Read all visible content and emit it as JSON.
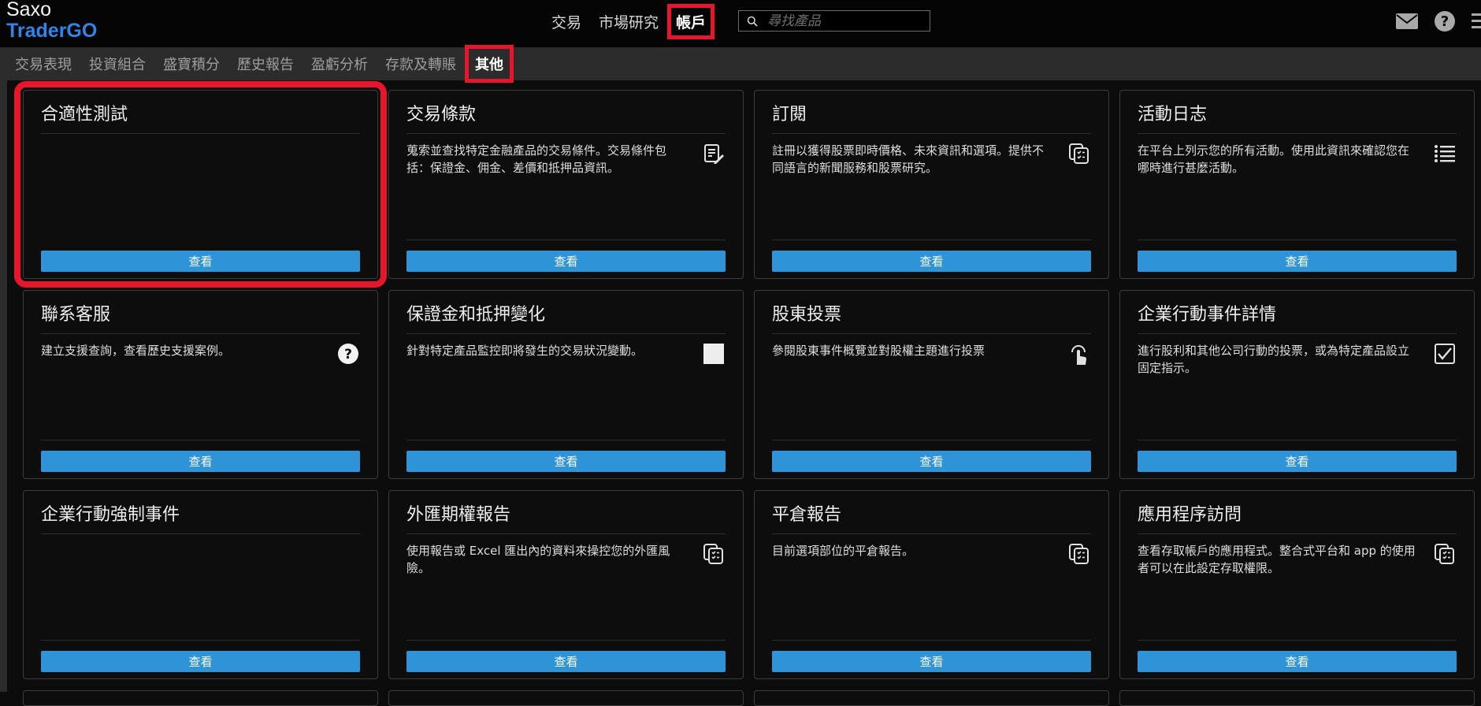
{
  "brand": {
    "line1": "Saxo",
    "line2": "TraderGO"
  },
  "main_nav": [
    {
      "label": "交易",
      "active": false
    },
    {
      "label": "市場研究",
      "active": false
    },
    {
      "label": "帳戶",
      "active": true
    }
  ],
  "search": {
    "placeholder": "尋找產品"
  },
  "top_icons": [
    "mail-icon",
    "help-icon",
    "menu-icon"
  ],
  "sub_tabs": [
    {
      "label": "交易表現",
      "active": false
    },
    {
      "label": "投資組合",
      "active": false
    },
    {
      "label": "盛寶積分",
      "active": false
    },
    {
      "label": "歷史報告",
      "active": false
    },
    {
      "label": "盈虧分析",
      "active": false
    },
    {
      "label": "存款及轉賬",
      "active": false
    },
    {
      "label": "其他",
      "active": true
    }
  ],
  "cards": [
    {
      "title": "合適性測試",
      "desc": "",
      "icon": "none",
      "button": "查看",
      "highlighted": true
    },
    {
      "title": "交易條款",
      "desc": "蒐索並查找特定金融產品的交易條件。交易條件包括：保證金、佣金、差價和抵押品資訊。",
      "icon": "document-edit-icon",
      "button": "查看"
    },
    {
      "title": "訂閱",
      "desc": "註冊以獲得股票即時價格、未來資訊和選項。提供不同語言的新聞服務和股票研究。",
      "icon": "report-stack-icon",
      "button": "查看"
    },
    {
      "title": "活動日志",
      "desc": "在平台上列示您的所有活動。使用此資訊來確認您在哪時進行甚麼活動。",
      "icon": "list-icon",
      "button": "查看"
    },
    {
      "title": "聯系客服",
      "desc": "建立支援查詢，查看歷史支援案例。",
      "icon": "question-circle-icon",
      "button": "查看"
    },
    {
      "title": "保證金和抵押變化",
      "desc": "針對特定產品監控即將發生的交易狀況變動。",
      "icon": "blank-square-icon",
      "button": "查看"
    },
    {
      "title": "股東投票",
      "desc": "參閱股東事件概覽並對股權主題進行投票",
      "icon": "touch-icon",
      "button": "查看"
    },
    {
      "title": "企業行動事件詳情",
      "desc": "進行股利和其他公司行動的投票，或為特定產品設立固定指示。",
      "icon": "checkbox-icon",
      "button": "查看"
    },
    {
      "title": "企業行動強制事件",
      "desc": "",
      "icon": "none",
      "button": "查看"
    },
    {
      "title": "外匯期權報告",
      "desc": "使用報告或 Excel 匯出內的資料來操控您的外匯風險。",
      "icon": "report-stack-icon",
      "button": "查看"
    },
    {
      "title": "平倉報告",
      "desc": "目前選項部位的平倉報告。",
      "icon": "report-stack-icon",
      "button": "查看"
    },
    {
      "title": "應用程序訪問",
      "desc": "查看存取帳戶的應用程式。整合式平台和 app 的使用者可以在此設定存取權限。",
      "icon": "report-stack-icon",
      "button": "查看"
    }
  ],
  "colors": {
    "accent": "#2f93d7",
    "brand": "#2f86e8",
    "highlight": "#e8162c"
  }
}
